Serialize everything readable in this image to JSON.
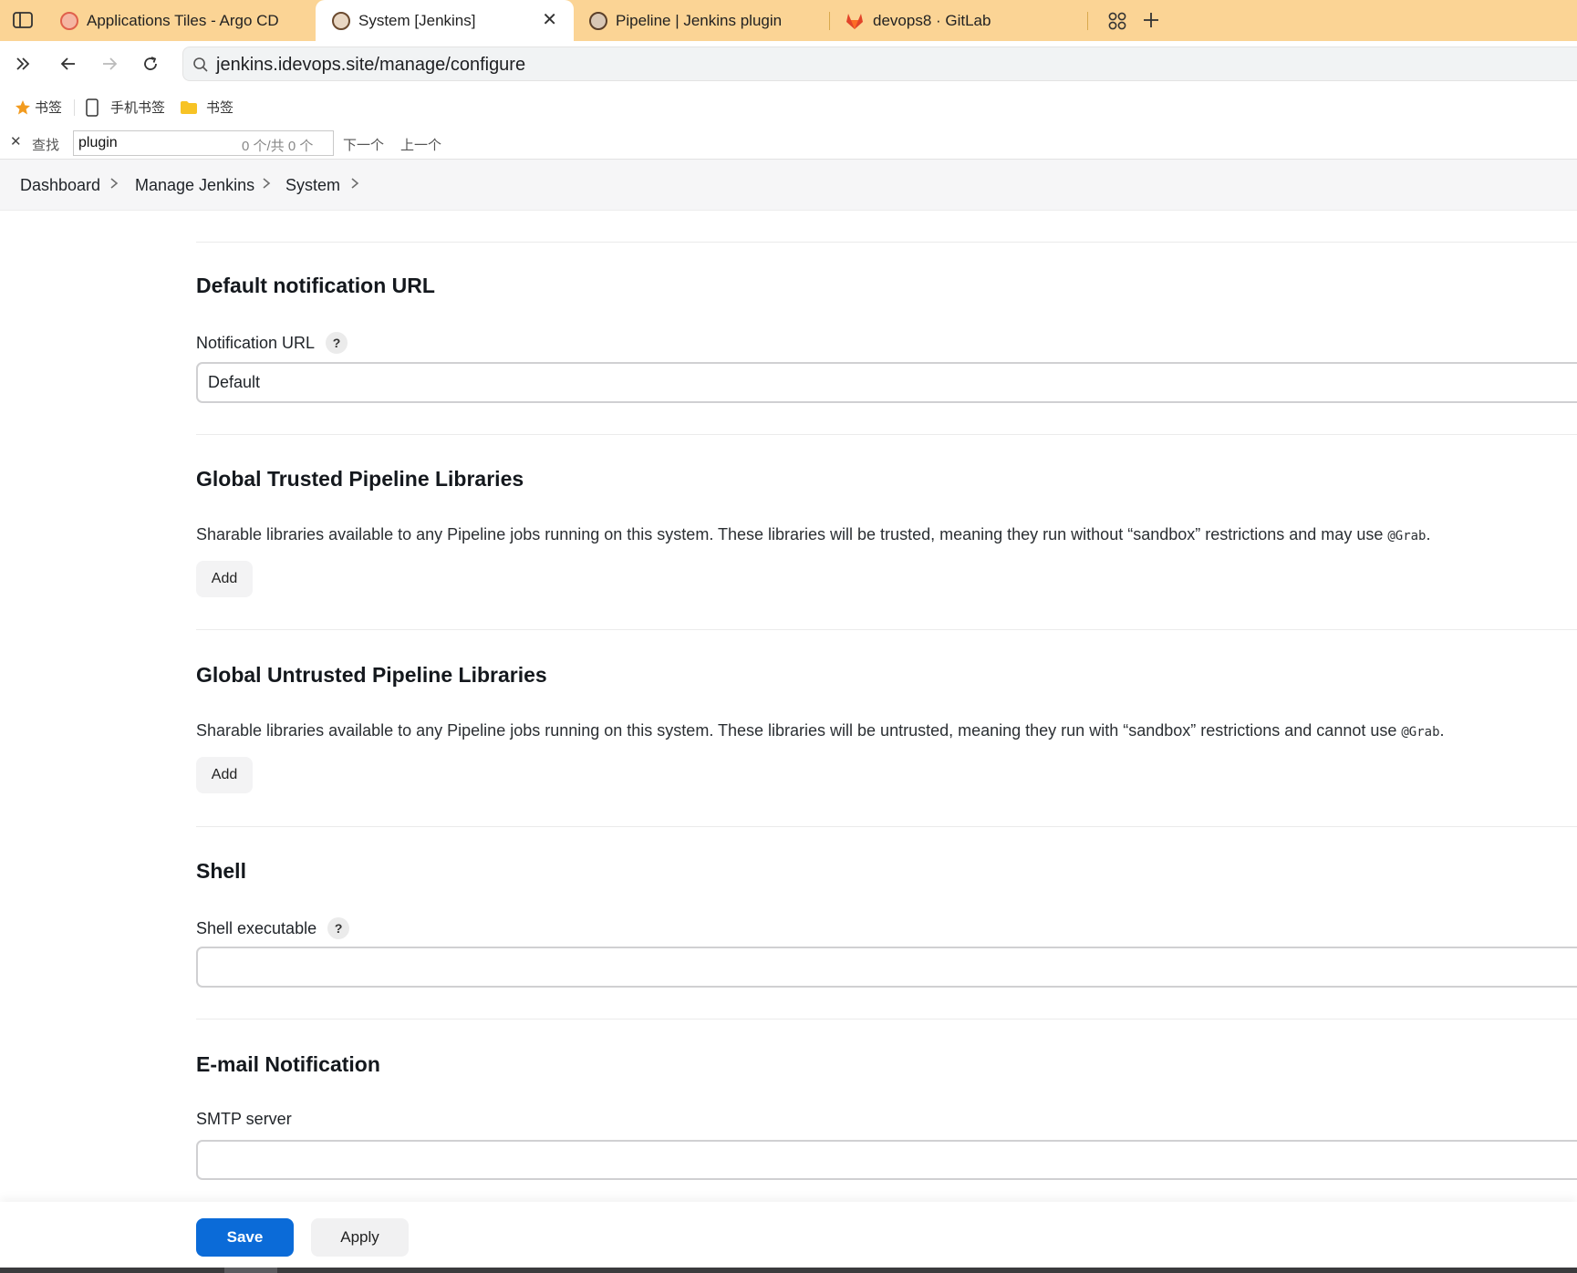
{
  "browser": {
    "tabs": [
      {
        "label": "Applications Tiles - Argo CD",
        "icon": "argo-favicon",
        "active": false
      },
      {
        "label": "System [Jenkins]",
        "icon": "jenkins-favicon",
        "active": true
      },
      {
        "label": "Pipeline | Jenkins plugin",
        "icon": "jenkins-plugin-favicon",
        "active": false
      },
      {
        "label": "devops8 · GitLab",
        "icon": "gitlab-favicon",
        "active": false
      }
    ],
    "tab_close": "✕",
    "url": "jenkins.idevops.site/manage/configure",
    "bookmarks": [
      {
        "label": "书签",
        "icon": "star-icon"
      },
      {
        "label": "手机书签",
        "icon": "phone-icon"
      },
      {
        "label": "书签",
        "icon": "folder-icon"
      }
    ],
    "find": {
      "close": "✕",
      "label": "查找",
      "query": "plugin",
      "count": "0 个/共 0 个",
      "next": "下一个",
      "prev": "上一个"
    },
    "accent": "#fbd495"
  },
  "breadcrumb": [
    "Dashboard",
    "Manage Jenkins",
    "System"
  ],
  "sections": {
    "notification": {
      "title": "Default notification URL",
      "field_label": "Notification URL",
      "field_value": "Default"
    },
    "trusted": {
      "title": "Global Trusted Pipeline Libraries",
      "desc_before": "Sharable libraries available to any Pipeline jobs running on this system. These libraries will be trusted, meaning they run without “sandbox” restrictions and may use ",
      "desc_code": "@Grab",
      "desc_after": ".",
      "add_label": "Add"
    },
    "untrusted": {
      "title": "Global Untrusted Pipeline Libraries",
      "desc_before": "Sharable libraries available to any Pipeline jobs running on this system. These libraries will be untrusted, meaning they run with “sandbox” restrictions and cannot use ",
      "desc_code": "@Grab",
      "desc_after": ".",
      "add_label": "Add"
    },
    "shell": {
      "title": "Shell",
      "field_label": "Shell executable",
      "field_value": ""
    },
    "email": {
      "title": "E-mail Notification",
      "field_label": "SMTP server",
      "field_value": ""
    }
  },
  "help_glyph": "?",
  "actions": {
    "save": "Save",
    "apply": "Apply",
    "save_color": "#0b6bd8"
  }
}
